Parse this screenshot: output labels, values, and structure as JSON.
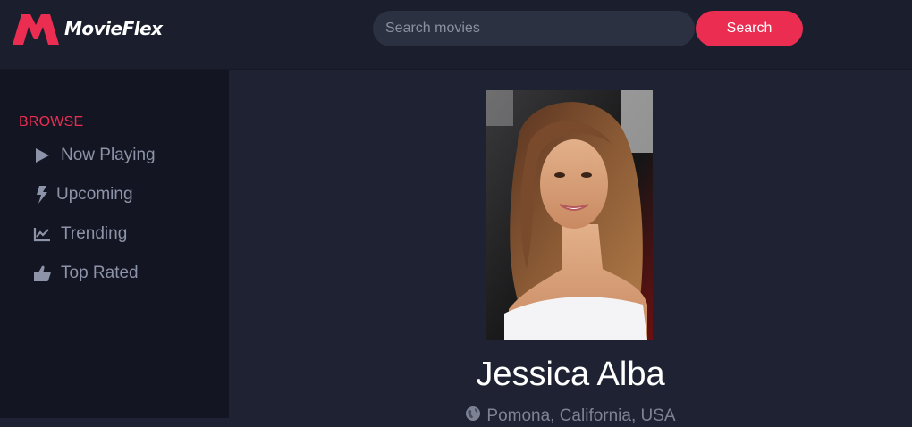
{
  "brand": {
    "name": "MovieFlex",
    "accent_color": "#ec2d52"
  },
  "search": {
    "placeholder": "Search movies",
    "value": "",
    "button_label": "Search"
  },
  "sidebar": {
    "heading": "BROWSE",
    "items": [
      {
        "label": "Now Playing",
        "icon": "play-icon"
      },
      {
        "label": "Upcoming",
        "icon": "lightning-icon"
      },
      {
        "label": "Trending",
        "icon": "trend-chart-icon"
      },
      {
        "label": "Top Rated",
        "icon": "thumbs-up-icon"
      }
    ]
  },
  "actor": {
    "name": "Jessica Alba",
    "birthplace": "Pomona, California, USA",
    "birthplace_icon": "globe-icon"
  }
}
